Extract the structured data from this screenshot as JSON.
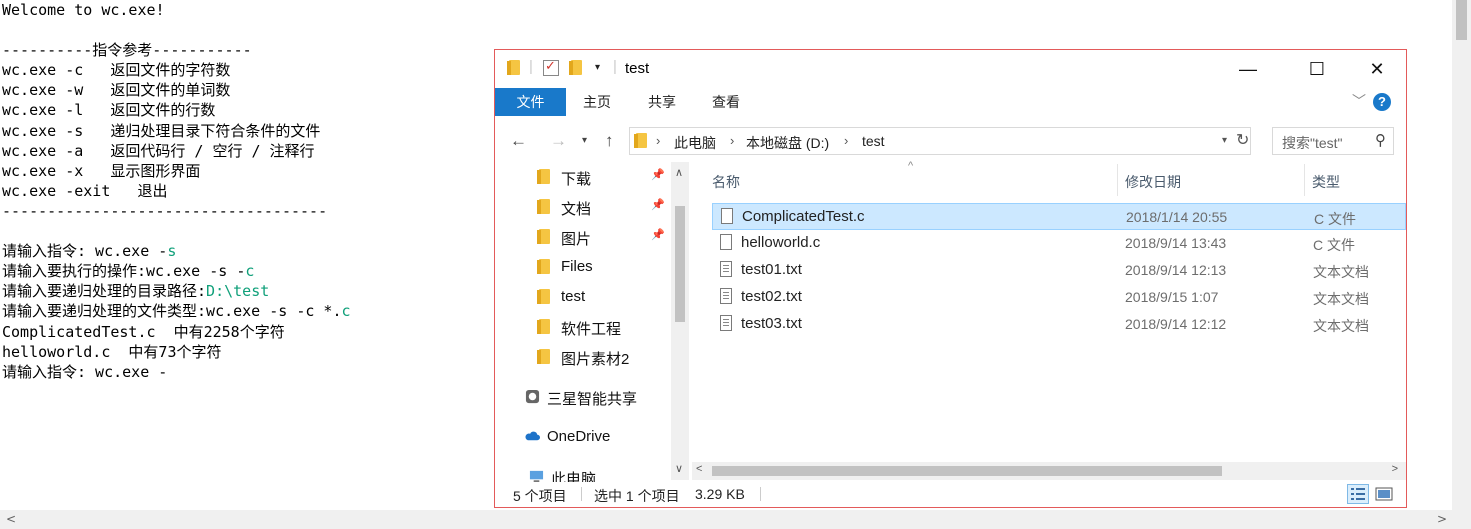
{
  "console": {
    "lines": [
      "Welcome to wc.exe!",
      "",
      "----------指令参考-----------",
      "wc.exe -c   返回文件的字符数",
      "wc.exe -w   返回文件的单词数",
      "wc.exe -l   返回文件的行数",
      "wc.exe -s   递归处理目录下符合条件的文件",
      "wc.exe -a   返回代码行 / 空行 / 注释行",
      "wc.exe -x   显示图形界面",
      "wc.exe -exit   退出",
      "------------------------------------",
      "",
      "请输入指令: wc.exe -",
      "请输入要执行的操作:wc.exe -s -",
      "请输入要递归处理的目录路径:",
      "请输入要递归处理的文件类型:wc.exe -s -c *.",
      "ComplicatedTest.c  中有2258个字符",
      "helloworld.c  中有73个字符",
      "请输入指令: wc.exe -"
    ],
    "green_parts": {
      "12": "s",
      "13": "c",
      "14": "D:\\test",
      "15": "c"
    },
    "accent_color": "#10a07a"
  },
  "explorer": {
    "title": "test",
    "window_buttons": {
      "minimize": "—",
      "maximize": "☐",
      "close": "✕"
    },
    "menu": {
      "file": "文件",
      "home": "主页",
      "share": "共享",
      "view": "查看"
    },
    "address": {
      "crumbs": [
        "此电脑",
        "本地磁盘 (D:)",
        "test"
      ]
    },
    "search_placeholder": "搜索\"test\"",
    "nav_items": [
      {
        "label": "下载",
        "icon": "download-folder-icon",
        "pinned": true
      },
      {
        "label": "文档",
        "icon": "documents-folder-icon",
        "pinned": true
      },
      {
        "label": "图片",
        "icon": "pictures-folder-icon",
        "pinned": true
      },
      {
        "label": "Files",
        "icon": "folder-icon",
        "pinned": false
      },
      {
        "label": "test",
        "icon": "folder-icon",
        "pinned": false
      },
      {
        "label": "软件工程",
        "icon": "folder-icon",
        "pinned": false
      },
      {
        "label": "图片素材2",
        "icon": "folder-icon",
        "pinned": false
      },
      {
        "label": "三星智能共享",
        "icon": "samsung-share-icon",
        "pinned": false
      },
      {
        "label": "OneDrive",
        "icon": "onedrive-cloud-icon",
        "pinned": false
      },
      {
        "label": "此电脑",
        "icon": "this-pc-icon",
        "pinned": false
      }
    ],
    "columns": {
      "name": "名称",
      "date": "修改日期",
      "type": "类型"
    },
    "files": [
      {
        "name": "ComplicatedTest.c",
        "date": "2018/1/14 20:55",
        "type": "C 文件",
        "selected": true,
        "kind": "c"
      },
      {
        "name": "helloworld.c",
        "date": "2018/9/14 13:43",
        "type": "C 文件",
        "selected": false,
        "kind": "c"
      },
      {
        "name": "test01.txt",
        "date": "2018/9/14 12:13",
        "type": "文本文档",
        "selected": false,
        "kind": "txt"
      },
      {
        "name": "test02.txt",
        "date": "2018/9/15 1:07",
        "type": "文本文档",
        "selected": false,
        "kind": "txt"
      },
      {
        "name": "test03.txt",
        "date": "2018/9/14 12:12",
        "type": "文本文档",
        "selected": false,
        "kind": "txt"
      }
    ],
    "status": {
      "count": "5 个项目",
      "selection": "选中 1 个项目",
      "size": "3.29 KB"
    },
    "colors": {
      "ribbon_accent": "#1979ca",
      "selection_bg": "#cce8ff",
      "border": "#e35a5a"
    }
  }
}
